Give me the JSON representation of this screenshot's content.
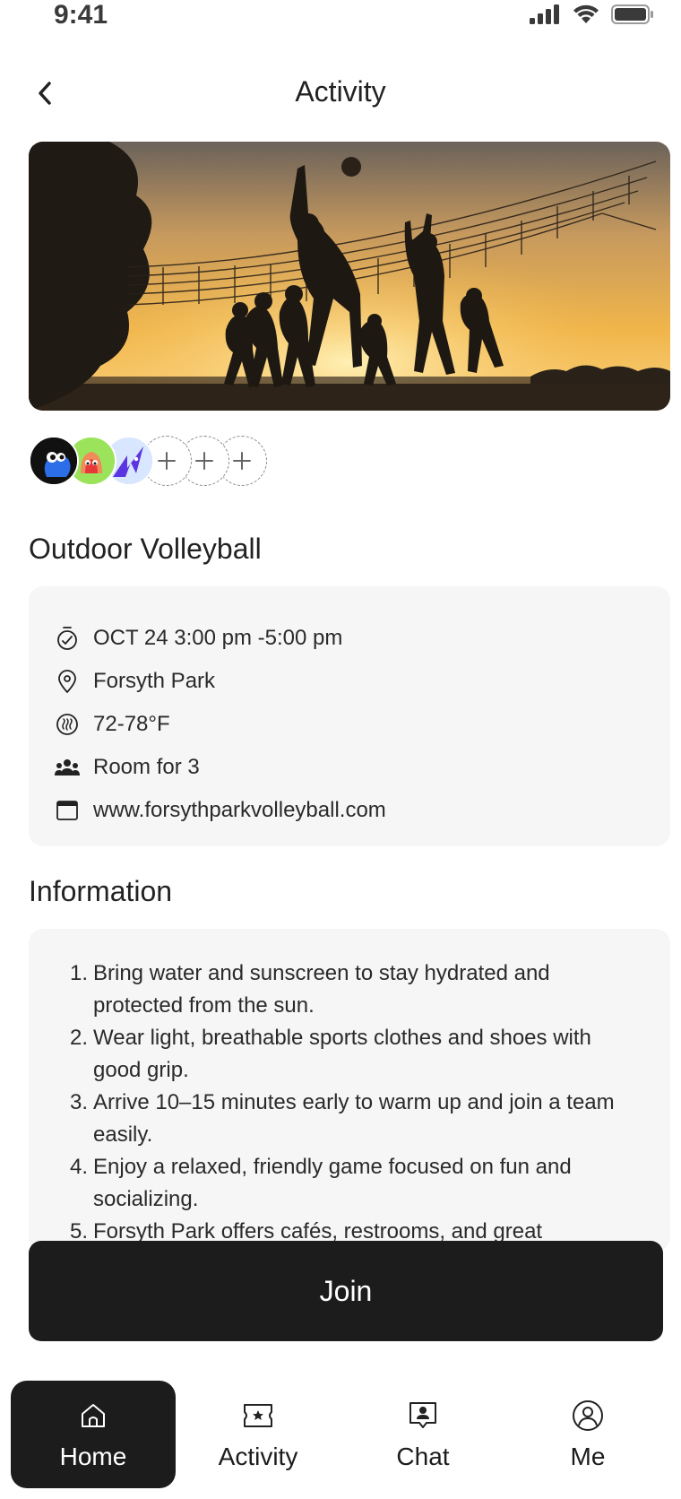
{
  "status_bar": {
    "time": "9:41"
  },
  "header": {
    "title": "Activity"
  },
  "event": {
    "title": "Outdoor Volleyball",
    "details": [
      {
        "icon": "timer-icon",
        "text": "OCT 24 3:00 pm -5:00 pm"
      },
      {
        "icon": "location-pin-icon",
        "text": "Forsyth Park"
      },
      {
        "icon": "temperature-icon",
        "text": "72-78°F"
      },
      {
        "icon": "group-icon",
        "text": "Room for 3"
      },
      {
        "icon": "browser-window-icon",
        "text": "www.forsythparkvolleyball.com"
      }
    ],
    "open_slots": 3
  },
  "information": {
    "title": "Information",
    "items": [
      {
        "num": "1.",
        "text": "Bring water and sunscreen to stay hydrated and protected from the sun."
      },
      {
        "num": "2.",
        "text": "Wear light, breathable sports clothes and shoes with good grip."
      },
      {
        "num": "3.",
        "text": "Arrive 10–15 minutes early to warm up and join a team easily."
      },
      {
        "num": "4.",
        "text": "Enjoy a relaxed, friendly game focused on fun and socializing."
      },
      {
        "num": "5.",
        "text": "Forsyth Park offers cafés, restrooms, and great"
      }
    ]
  },
  "join_label": "Join",
  "nav": {
    "items": [
      {
        "label": "Home",
        "icon": "home-icon",
        "active": true
      },
      {
        "label": "Activity",
        "icon": "ticket-star-icon",
        "active": false
      },
      {
        "label": "Chat",
        "icon": "chat-profile-icon",
        "active": false
      },
      {
        "label": "Me",
        "icon": "user-circle-icon",
        "active": false
      }
    ]
  },
  "colors": {
    "dark": "#1c1c1c",
    "card_bg": "#f6f6f6",
    "sunset": "#e9a53c"
  }
}
